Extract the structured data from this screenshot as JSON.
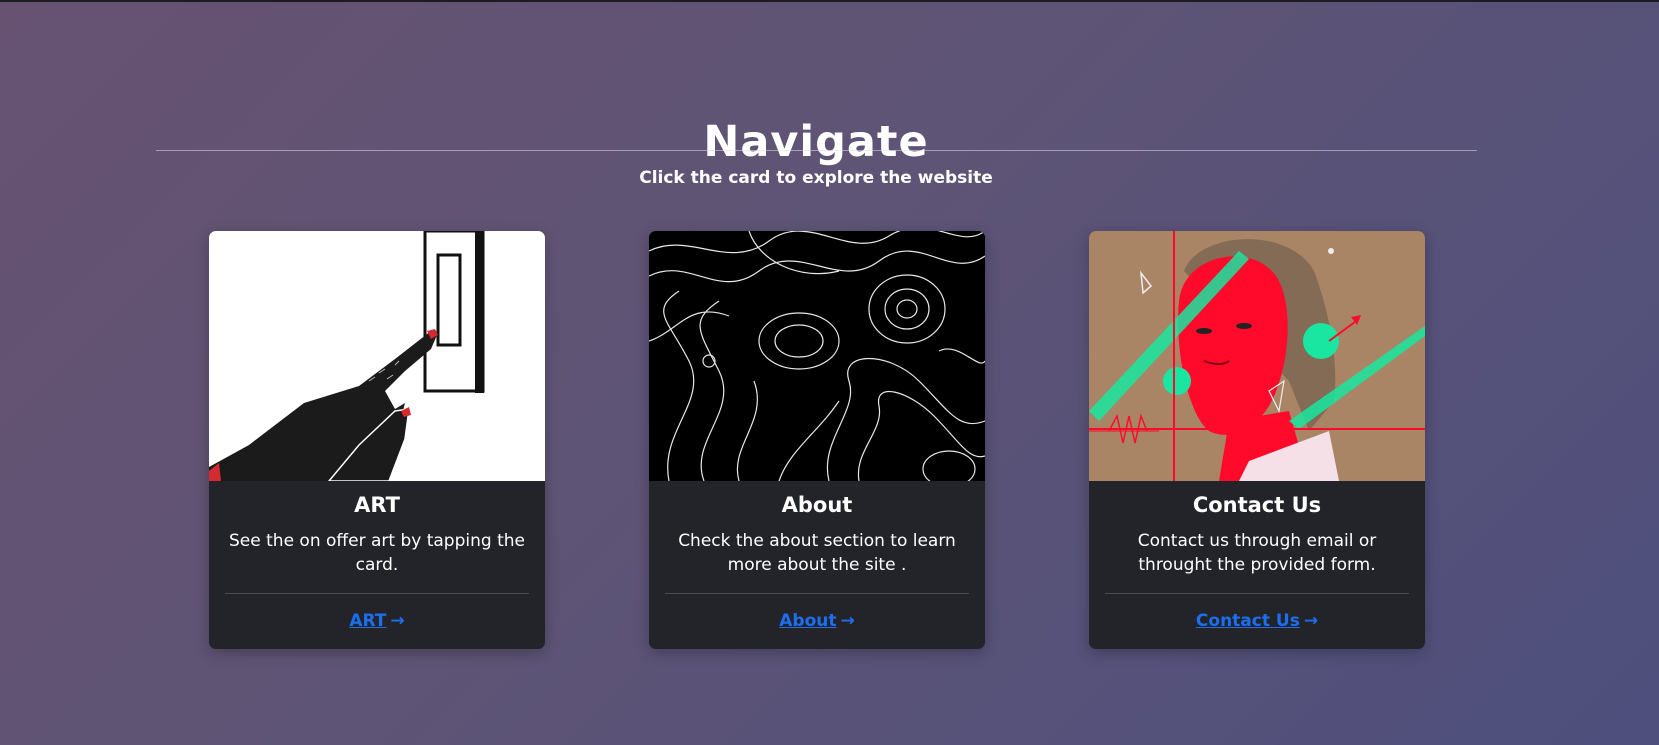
{
  "header": {
    "title": "Navigate",
    "subtitle": "Click the card to explore the website"
  },
  "cards": [
    {
      "title": "ART",
      "text": "See the on offer art by tapping the card.",
      "link_label": "ART",
      "image_icon": "hand-pressing-switch-illustration"
    },
    {
      "title": "About",
      "text": "Check the about section to learn more about the site .",
      "link_label": "About",
      "image_icon": "topographic-contour-lines"
    },
    {
      "title": "Contact Us",
      "text": "Contact us through email or throught the provided form.",
      "link_label": "Contact Us",
      "image_icon": "red-portrait-woman-illustration"
    }
  ],
  "icons": {
    "arrow": "→"
  },
  "colors": {
    "link": "#1e6ff0",
    "card_bg": "#222429",
    "accent_red": "#ff0a2a",
    "accent_green": "#19e6a0"
  }
}
